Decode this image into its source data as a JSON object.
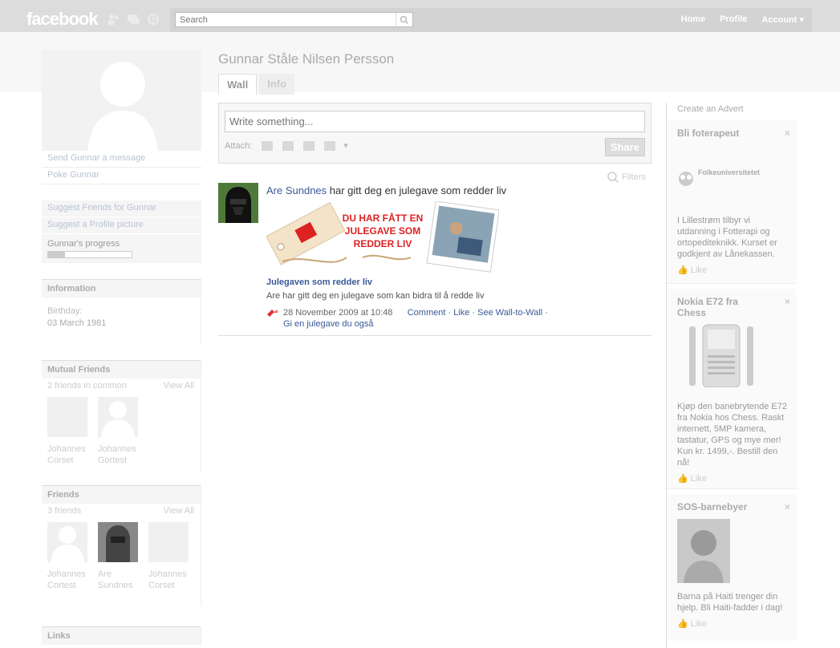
{
  "topbar": {
    "logo": "facebook",
    "search_placeholder": "Search",
    "nav": [
      "Home",
      "Profile",
      "Account ▾"
    ]
  },
  "profile": {
    "name": "Gunnar Ståle Nilsen Persson",
    "tabs": [
      "Wall",
      "Info"
    ]
  },
  "left": {
    "actions": [
      "Send Gunnar a message",
      "Poke Gunnar"
    ],
    "suggest": [
      "Suggest Friends for Gunnar",
      "Suggest a Profile picture"
    ],
    "progress_label": "Gunnar's progress",
    "progress_value": 0.2,
    "information": {
      "title": "Information",
      "birthday_label": "Birthday:",
      "birthday": "03 March 1981"
    },
    "mutual": {
      "title": "Mutual Friends",
      "count": "2 friends in common",
      "view_all": "View All",
      "friends": [
        [
          "Johannes",
          "Corset"
        ],
        [
          "Johannes",
          "Gortest"
        ]
      ]
    },
    "friends": {
      "title": "Friends",
      "count": "3 friends",
      "view_all": "View All",
      "list": [
        [
          "Johannes",
          "Cortest"
        ],
        [
          "Are",
          "Sundnes"
        ],
        [
          "Johannes",
          "Corset"
        ]
      ]
    },
    "links_title": "Links"
  },
  "composer": {
    "placeholder": "Write something...",
    "attach_label": "Attach:",
    "share_label": "Share",
    "filters_label": "Filters"
  },
  "story": {
    "actor": "Are Sundnes",
    "text": " har gitt deg en julegave som redder liv",
    "banner_line1": "DU HAR FÅTT EN",
    "banner_line2": "JULEGAVE SOM",
    "banner_line3": "REDDER LIV",
    "title": "Julegaven som redder liv",
    "desc": "Are har gitt deg en julegave som kan bidra til å redde liv",
    "date": "28 November 2009 at 10:48",
    "comment": "Comment",
    "like": "Like",
    "wall": "See Wall-to-Wall",
    "give": "Gi en julegave du også"
  },
  "ads": {
    "create": "Create an Advert",
    "items": [
      {
        "title": "Bli foterapeut",
        "brand": "Folkeuniversitetet",
        "body": "I Lillestrøm tilbyr vi utdanning i Fotterapi og ortopediteknikk. Kurset er godkjent av Lånekassen.",
        "like": "Like"
      },
      {
        "title": "Nokia E72 fra Chess",
        "body": "Kjøp den banebrytende E72 fra Nokia hos Chess. Raskt internett, 5MP kamera, tastatur, GPS og mye mer! Kun kr. 1499,-. Bestill den nå!",
        "like": "Like"
      },
      {
        "title": "SOS-barnebyer",
        "body": "Barna på Haiti trenger din hjelp. Bli Haiti-fadder i dag!",
        "like": "Like"
      }
    ]
  }
}
